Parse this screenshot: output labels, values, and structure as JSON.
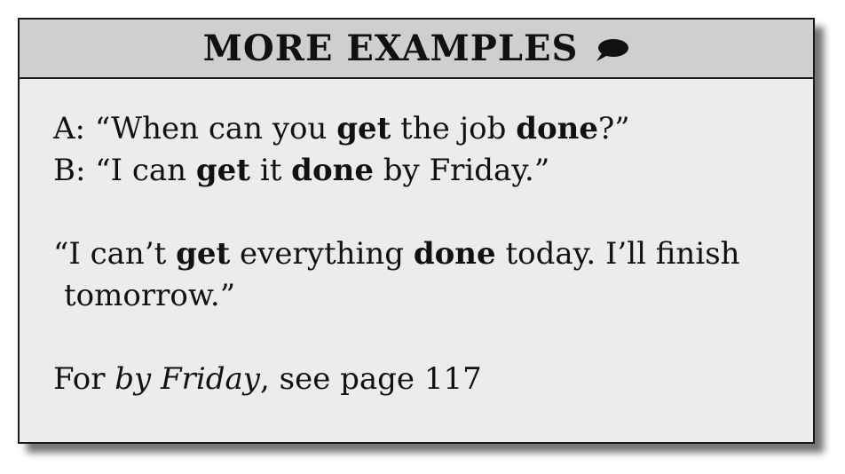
{
  "header": {
    "title": "MORE EXAMPLES",
    "icon": "speech-bubble-icon"
  },
  "dialogue": {
    "a_prefix": "A: “When can you ",
    "a_bold1": "get",
    "a_mid": " the job ",
    "a_bold2": "done",
    "a_suffix": "?”",
    "b_prefix": "B: “I can ",
    "b_bold1": "get",
    "b_mid": " it ",
    "b_bold2": "done",
    "b_suffix": " by Friday.”"
  },
  "example": {
    "prefix": "“I can’t ",
    "bold1": "get",
    "mid": " everything ",
    "bold2": "done",
    "suffix": " today. I’ll finish",
    "line2": "tomorrow.”"
  },
  "reference": {
    "prefix": "For ",
    "italic": "by Friday",
    "suffix": ", see page 117"
  }
}
